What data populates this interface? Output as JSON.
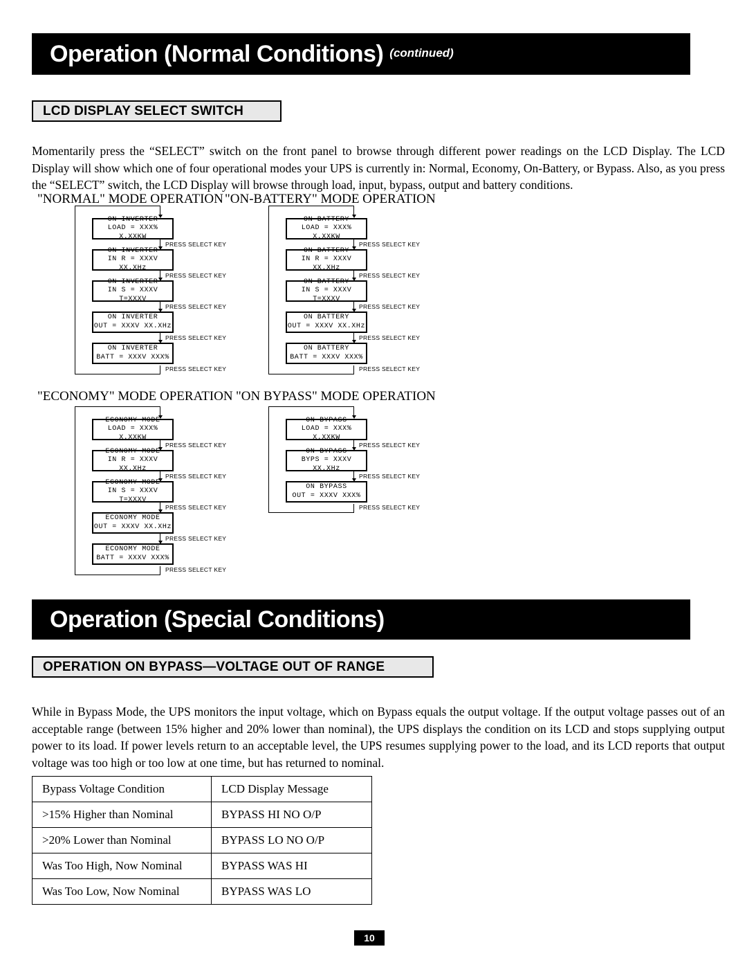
{
  "document": {
    "page_number": "10"
  },
  "section_1": {
    "banner_title": "Operation (Normal Conditions)",
    "banner_sub": "(continued)",
    "subhead": "LCD DISPLAY SELECT SWITCH",
    "paragraph": "Momentarily press the “SELECT” switch on the front panel to browse through different power readings on the LCD Display. The LCD Display will show which one of four operational modes your UPS is currently in: Normal, Economy, On-Battery, or Bypass.  Also, as you press the “SELECT” switch, the LCD Display will browse through load, input, bypass, output and battery conditions.",
    "press_select_label": "PRESS SELECT KEY",
    "diagrams": [
      {
        "label": "\"NORMAL\" MODE OPERATION",
        "screens": [
          {
            "line1": "ON INVERTER",
            "line2": "LOAD = XXX% X.XXKW"
          },
          {
            "line1": "ON INVERTER",
            "line2": "IN R = XXXV XX.XHz"
          },
          {
            "line1": "ON INVERTER",
            "line2": "IN S = XXXV T=XXXV"
          },
          {
            "line1": "ON INVERTER",
            "line2": "OUT = XXXV XX.XHz"
          },
          {
            "line1": "ON INVERTER",
            "line2": "BATT = XXXV XXX%"
          }
        ]
      },
      {
        "label": "\"ON-BATTERY\" MODE OPERATION",
        "screens": [
          {
            "line1": "ON BATTERY",
            "line2": "LOAD = XXX% X.XXKW"
          },
          {
            "line1": "ON BATTERY",
            "line2": "IN R = XXXV XX.XHz"
          },
          {
            "line1": "ON BATTERY",
            "line2": "IN S = XXXV T=XXXV"
          },
          {
            "line1": "ON BATTERY",
            "line2": "OUT = XXXV XX.XHz"
          },
          {
            "line1": "ON BATTERY",
            "line2": "BATT = XXXV XXX%"
          }
        ]
      },
      {
        "label": "\"ECONOMY\" MODE OPERATION",
        "screens": [
          {
            "line1": "ECONOMY MODE",
            "line2": "LOAD = XXX% X.XXKW"
          },
          {
            "line1": "ECONOMY MODE",
            "line2": "IN R = XXXV XX.XHz"
          },
          {
            "line1": "ECONOMY MODE",
            "line2": "IN S = XXXV T=XXXV"
          },
          {
            "line1": "ECONOMY MODE",
            "line2": "OUT = XXXV XX.XHz"
          },
          {
            "line1": "ECONOMY MODE",
            "line2": "BATT = XXXV XXX%"
          }
        ]
      },
      {
        "label": "\"ON BYPASS\" MODE OPERATION",
        "screens": [
          {
            "line1": "ON BYPASS",
            "line2": "LOAD = XXX% X.XXKW"
          },
          {
            "line1": "ON BYPASS",
            "line2": "BYPS = XXXV XX.XHz"
          },
          {
            "line1": "ON BYPASS",
            "line2": "OUT = XXXV XXX%"
          }
        ]
      }
    ]
  },
  "section_2": {
    "banner_title": "Operation (Special Conditions)",
    "subhead": "OPERATION ON BYPASS—VOLTAGE OUT OF RANGE",
    "paragraph": "While in Bypass Mode, the UPS monitors the input voltage, which on Bypass equals the output voltage. If the output voltage passes out of an acceptable range (between 15% higher and 20% lower than nominal), the UPS displays the condition on its LCD and stops supplying output power to its load. If power levels return to an acceptable level, the UPS resumes supplying power to the load, and its LCD reports that output voltage was too high or too low at one time, but has returned to nominal.",
    "table": {
      "headers": [
        "Bypass Voltage Condition",
        "LCD Display Message"
      ],
      "rows": [
        [
          ">15% Higher than Nominal",
          "BYPASS HI NO O/P"
        ],
        [
          ">20% Lower than Nominal",
          "BYPASS LO NO O/P"
        ],
        [
          "Was Too High, Now Nominal",
          "BYPASS WAS HI"
        ],
        [
          "Was Too Low, Now Nominal",
          "BYPASS WAS LO"
        ]
      ]
    }
  }
}
